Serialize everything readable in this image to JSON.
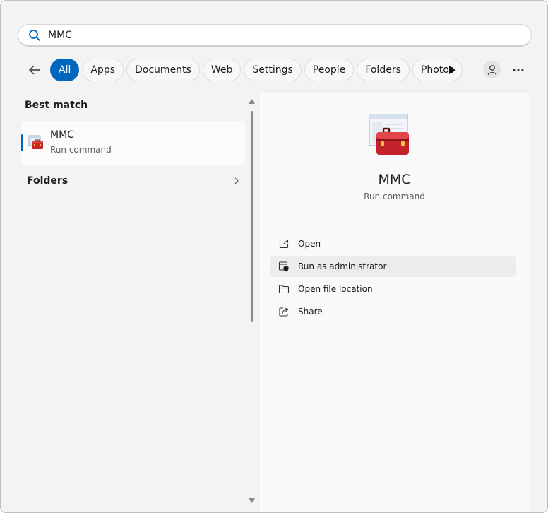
{
  "search": {
    "value": "MMC",
    "placeholder": ""
  },
  "filters": [
    {
      "label": "All",
      "active": true
    },
    {
      "label": "Apps"
    },
    {
      "label": "Documents"
    },
    {
      "label": "Web"
    },
    {
      "label": "Settings"
    },
    {
      "label": "People"
    },
    {
      "label": "Folders"
    },
    {
      "label": "Photos"
    }
  ],
  "left": {
    "best_match_title": "Best match",
    "best_item": {
      "name": "MMC",
      "sub": "Run command"
    },
    "folders_label": "Folders"
  },
  "detail": {
    "name": "MMC",
    "sub": "Run command",
    "actions": [
      {
        "label": "Open",
        "icon": "open-external-icon"
      },
      {
        "label": "Run as administrator",
        "icon": "shield-admin-icon"
      },
      {
        "label": "Open file location",
        "icon": "folder-icon"
      },
      {
        "label": "Share",
        "icon": "share-icon"
      }
    ]
  },
  "colors": {
    "accent": "#0067c0",
    "background": "#f3f3f3",
    "pane": "#f9f9f9"
  }
}
